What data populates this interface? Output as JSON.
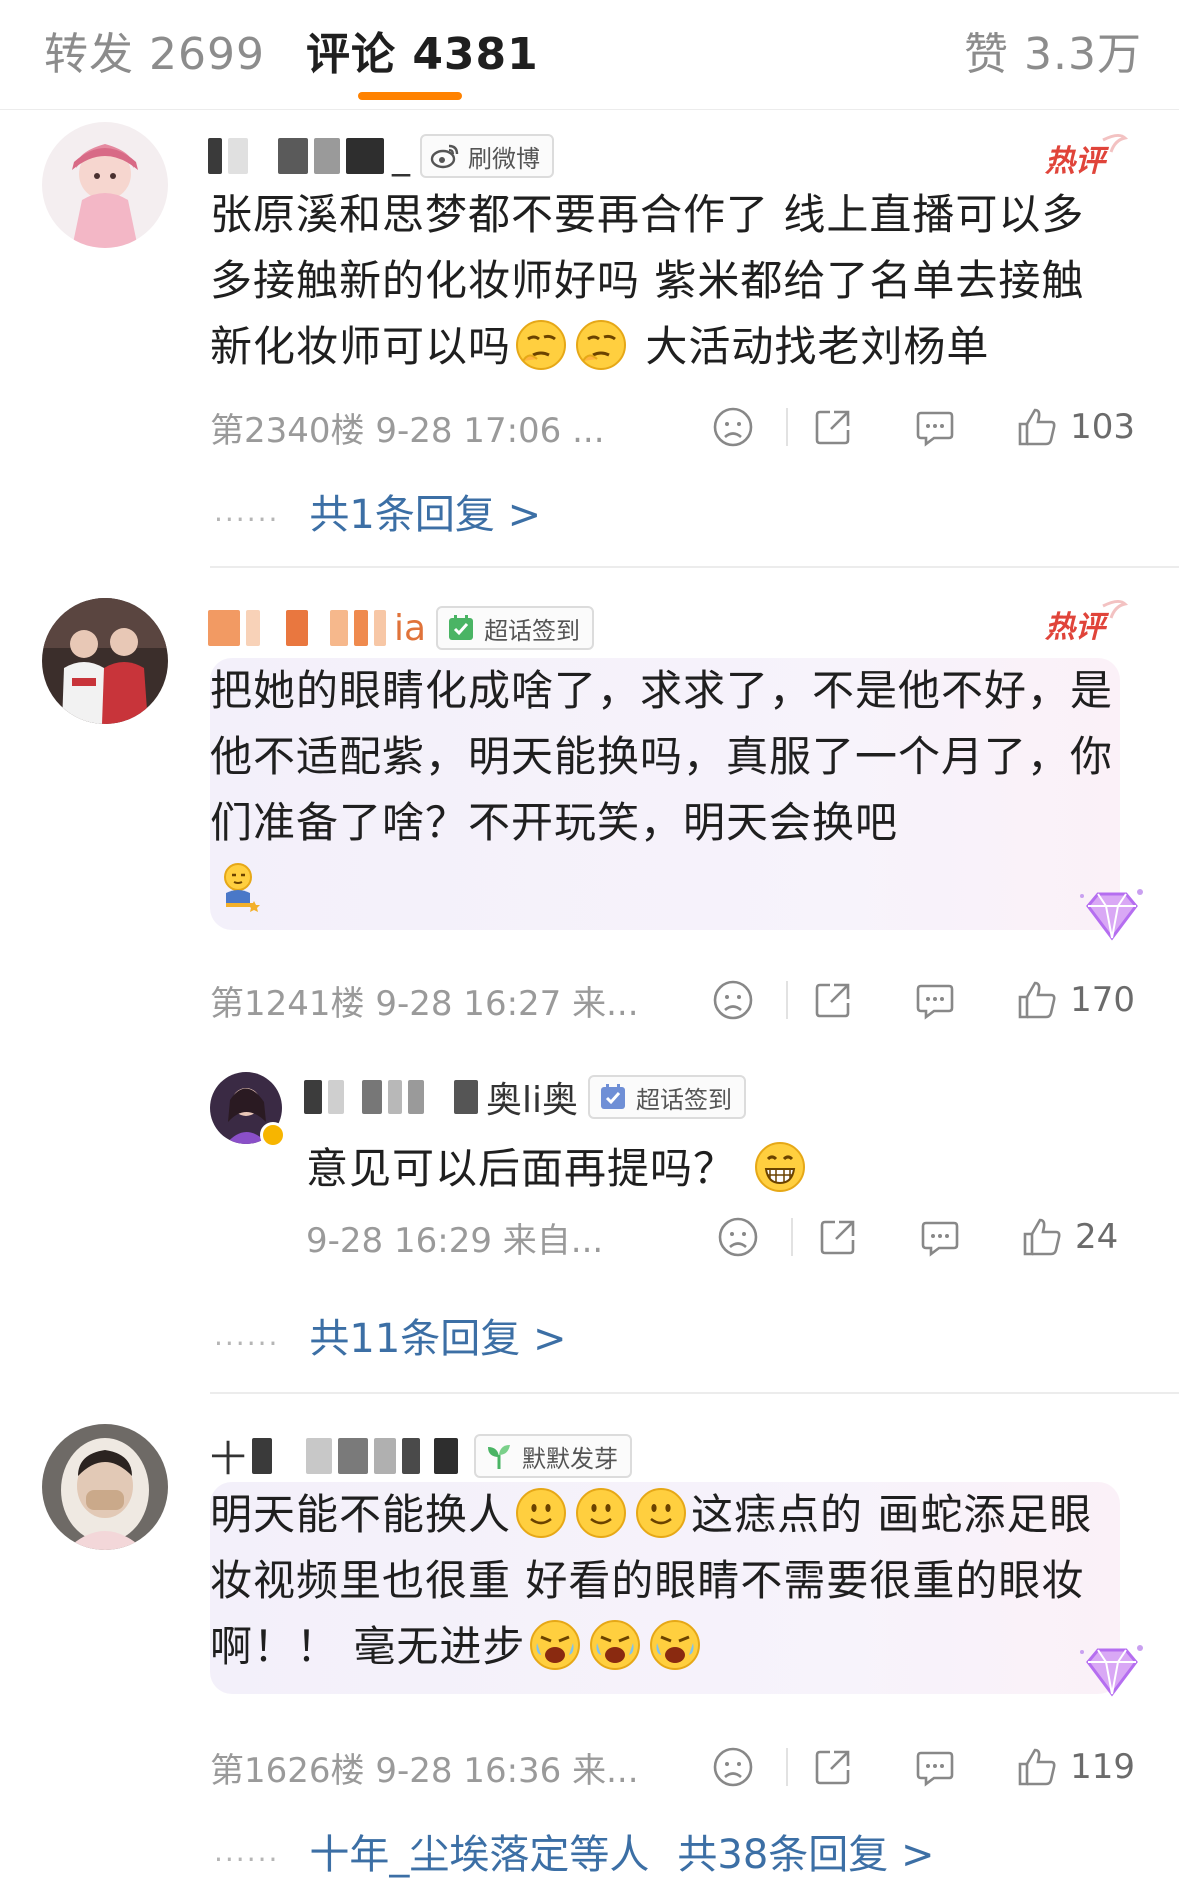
{
  "tabs": [
    {
      "label": "转发 2699"
    },
    {
      "label": "评论 4381"
    },
    {
      "label": "赞 3.3万"
    }
  ],
  "colors": {
    "accent": "#ff8200",
    "link": "#3c6fa5",
    "hot": "#e0443a"
  },
  "comments": [
    {
      "username_suffix": "_",
      "badge": "刷微博",
      "badge_icon": "weibo-logo-icon",
      "hot_label": "热评",
      "text_parts": [
        "张原溪和思梦都不要再合作了 线上直播可以多多接触新的化妆师好吗 紫米都给了名单去接触新化妆师可以吗",
        "大活动找老刘杨单"
      ],
      "emojis": [
        "thinking-emoji-icon",
        "thinking-emoji-icon"
      ],
      "meta": "第2340楼 9-28 17:06 ...",
      "likes": "103",
      "reply_link": "共1条回复 >"
    },
    {
      "username_suffix": "ia",
      "badge": "超话签到",
      "badge_icon": "checkin-icon",
      "hot_label": "热评",
      "text": "把她的眼睛化成啥了，求求了，不是他不好，是他不适配紫，明天能换吗，真服了一个月了，你们准备了啥？不开玩笑，明天会换吧",
      "emojis": [
        "kneeling-emoji-icon"
      ],
      "meta": "第1241楼 9-28 16:27 来...",
      "likes": "170",
      "sub_reply": {
        "username_suffix": "奥li奥",
        "badge": "超话签到",
        "text": "意见可以后面再提吗？",
        "emojis": [
          "grin-emoji-icon"
        ],
        "meta": "9-28 16:29 来自...",
        "likes": "24"
      },
      "reply_link": "共11条回复 >"
    },
    {
      "username_prefix": "十",
      "badge": "默默发芽",
      "badge_icon": "sprout-icon",
      "text_parts": [
        "明天能不能换人",
        "这痣点的 画蛇添足眼妆视频里也很重 好看的眼睛不需要很重的眼妆啊！！ 毫无进步"
      ],
      "emojis": [
        "smile-emoji-icon",
        "smile-emoji-icon",
        "smile-emoji-icon",
        "crying-emoji-icon",
        "crying-emoji-icon",
        "crying-emoji-icon"
      ],
      "meta": "第1626楼 9-28 16:36 来...",
      "likes": "119",
      "reply_who": "十年_尘埃落定等人",
      "reply_link": "共38条回复 >"
    }
  ],
  "dots": "......"
}
